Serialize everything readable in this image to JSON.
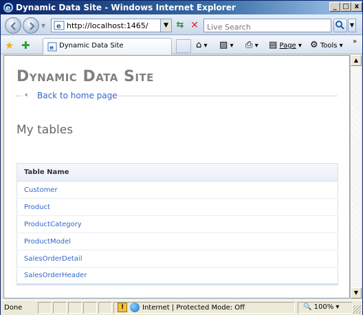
{
  "window": {
    "title": "Dynamic Data Site - Windows Internet Explorer",
    "min_glyph": "_",
    "max_glyph": "□",
    "close_glyph": "x"
  },
  "address": {
    "url": "http://localhost:1465/",
    "search_placeholder": "Live Search"
  },
  "tab": {
    "label": "Dynamic Data Site"
  },
  "commands": {
    "page_label": "Page",
    "tools_label": "Tools",
    "overflow": "»"
  },
  "page": {
    "site_title": "Dynamic Data Site",
    "back_link": "Back to home page",
    "section_title": "My tables",
    "table": {
      "header": "Table Name",
      "rows": [
        "Customer",
        "Product",
        "ProductCategory",
        "ProductModel",
        "SalesOrderDetail",
        "SalesOrderHeader"
      ]
    }
  },
  "status": {
    "text": "Done",
    "zone": "Internet | Protected Mode: Off",
    "zoom": "100%"
  },
  "colors": {
    "link": "#3366cc",
    "title_gray": "#7f7f7f",
    "titlebar": "#0a246a"
  }
}
